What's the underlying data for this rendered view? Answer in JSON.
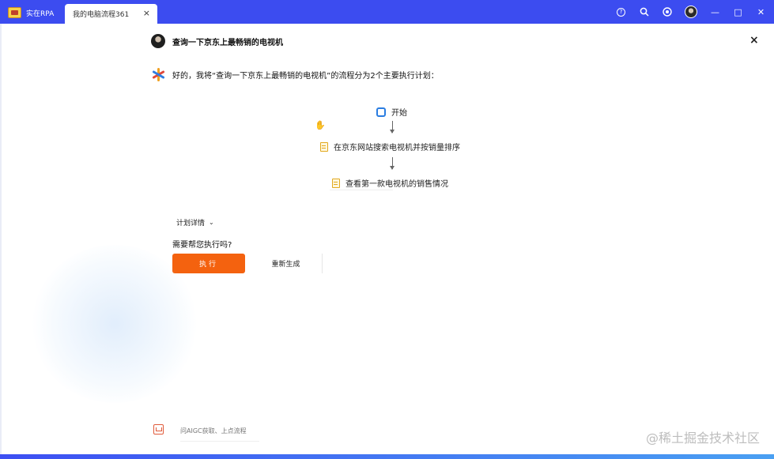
{
  "titlebar": {
    "app_name": "实在RPA",
    "tab_label": "我的电脑流程361",
    "tab_close": "×",
    "icons": [
      "help-icon",
      "search-icon",
      "record-icon",
      "avatar",
      "minimize-icon",
      "maximize-icon",
      "close-window-icon"
    ],
    "minimize": "—",
    "maximize": "□",
    "close": "✕",
    "accent": "#3c4cf0"
  },
  "chat": {
    "close": "×",
    "question": "查询一下京东上最畅销的电视机",
    "answer": "好的，我将“查询一下京东上最畅销的电视机”的流程分为2个主要执行计划："
  },
  "flow": {
    "start": "开始",
    "step1": "在京东网站搜索电视机并按销量排序",
    "step2": "查看第一款电视机的销售情况"
  },
  "plan": {
    "details": "计划详情",
    "prompt": "需要帮您执行吗?",
    "execute": "执行",
    "regenerate": "重新生成",
    "execute_color": "#f4620f"
  },
  "input": {
    "placeholder": "问AIGC获取、上点流程"
  },
  "watermark": "@稀土掘金技术社区"
}
